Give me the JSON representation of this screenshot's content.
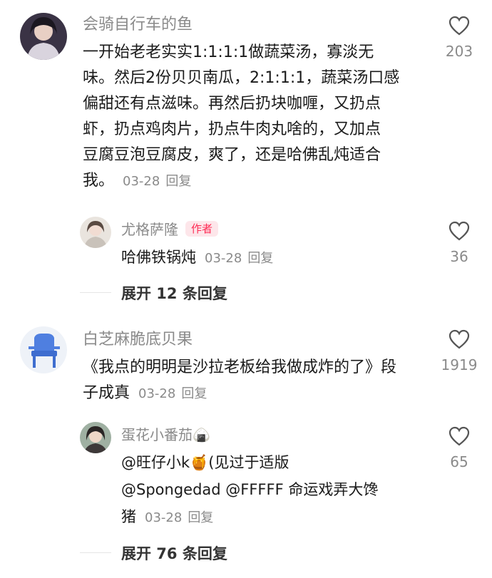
{
  "comments": [
    {
      "username": "会骑自行车的鱼",
      "text_lines": [
        "一开始老老实实1:1:1:1做蔬菜汤，寡淡无",
        "味。然后2份贝贝南瓜，2:1:1:1，蔬菜汤口感",
        "偏甜还有点滋味。再然后扔块咖喱，又扔点",
        "虾，扔点鸡肉片，扔点牛肉丸啥的，又加点",
        "豆腐豆泡豆腐皮，爽了，还是哈佛乱炖适合",
        "我。"
      ],
      "date": "03-28",
      "reply_label": "回复",
      "likes": "203",
      "replies": [
        {
          "username": "尤格萨隆",
          "badge": "作者",
          "text": "哈佛铁锅炖",
          "date": "03-28",
          "reply_label": "回复",
          "likes": "36"
        }
      ],
      "expand_label": "展开 12 条回复"
    },
    {
      "username": "白芝麻脆底贝果",
      "text_lines": [
        "《我点的明明是沙拉老板给我做成炸的了》段",
        "子成真"
      ],
      "date": "03-28",
      "reply_label": "回复",
      "likes": "1919",
      "replies": [
        {
          "username": "蛋花小番茄🍙",
          "text_lines": [
            "@旺仔小k🍯(见过于适版",
            "@Spongedad @FFFFF 命运戏弄大馋",
            "猪"
          ],
          "date": "03-28",
          "reply_label": "回复",
          "likes": "65"
        }
      ],
      "expand_label": "展开 76 条回复"
    }
  ],
  "colors": {
    "accent": "#fe2c55",
    "secondary_text": "#8a8a8a",
    "badge_bg": "#fde6ea"
  },
  "icons": {
    "like": "heart-outline-icon"
  }
}
